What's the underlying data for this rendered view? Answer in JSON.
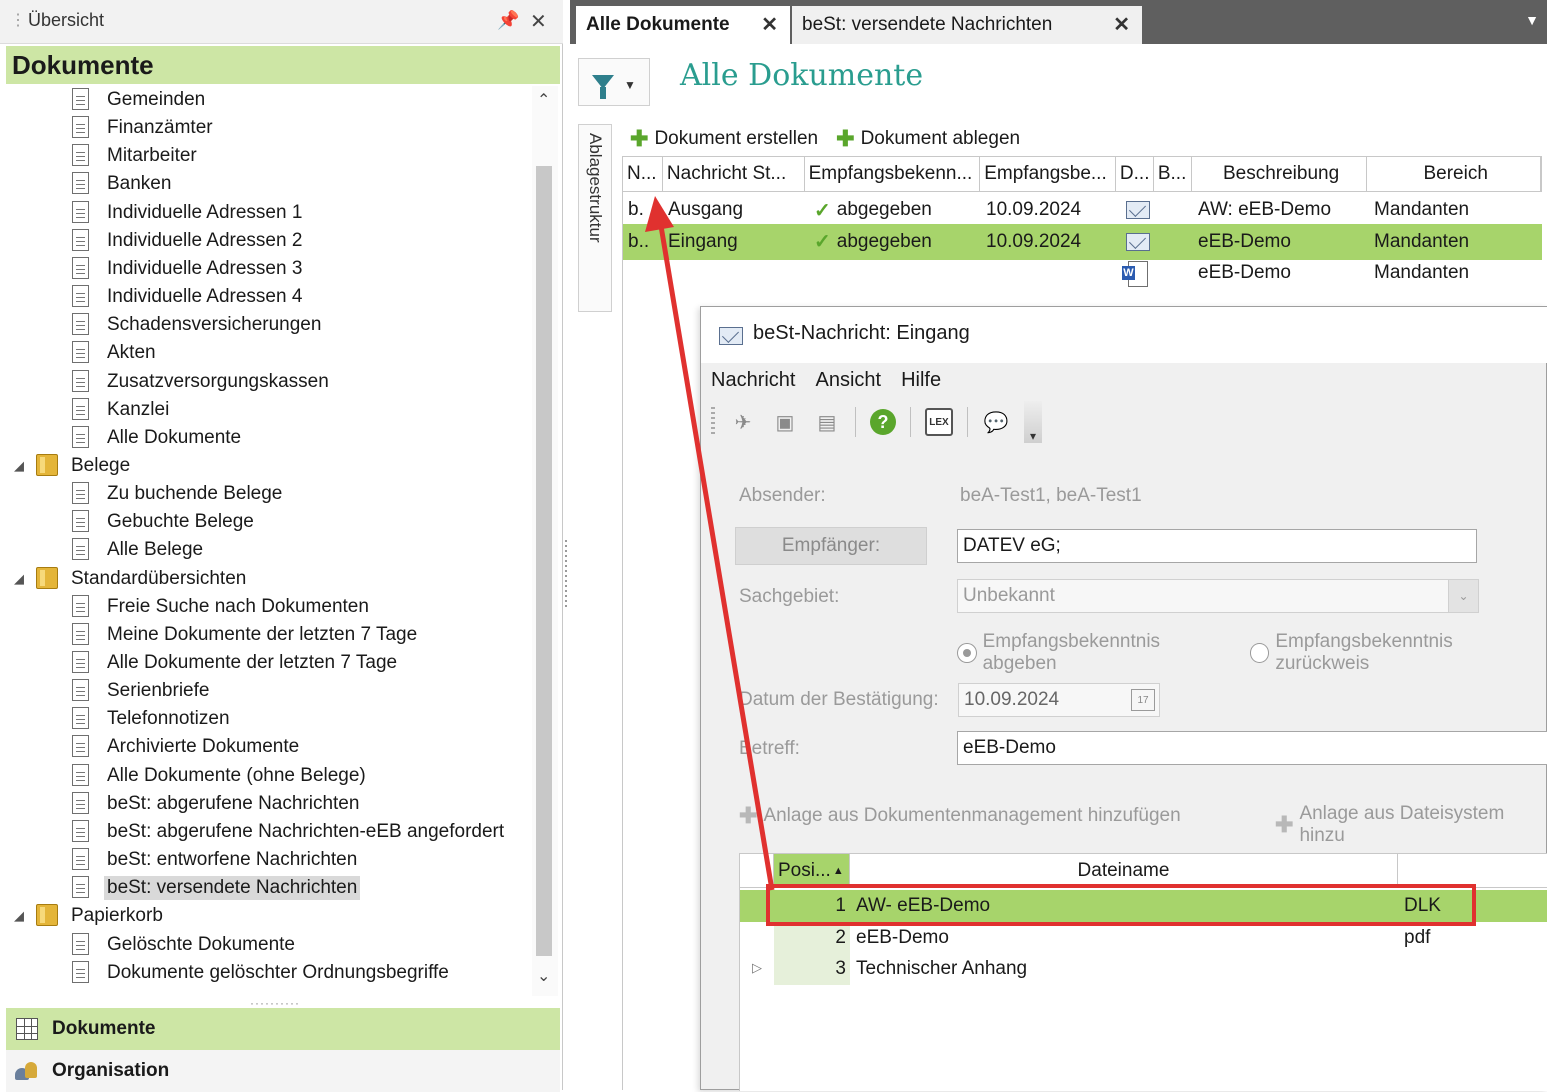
{
  "left_panel": {
    "title": "Übersicht",
    "header": "Dokumente",
    "tree": [
      {
        "label": "Gemeinden",
        "type": "doc",
        "level": 2
      },
      {
        "label": "Finanzämter",
        "type": "doc",
        "level": 2
      },
      {
        "label": "Mitarbeiter",
        "type": "doc",
        "level": 2
      },
      {
        "label": "Banken",
        "type": "doc",
        "level": 2
      },
      {
        "label": "Individuelle Adressen 1",
        "type": "doc",
        "level": 2
      },
      {
        "label": "Individuelle Adressen 2",
        "type": "doc",
        "level": 2
      },
      {
        "label": "Individuelle Adressen 3",
        "type": "doc",
        "level": 2
      },
      {
        "label": "Individuelle Adressen 4",
        "type": "doc",
        "level": 2
      },
      {
        "label": "Schadensversicherungen",
        "type": "doc",
        "level": 2
      },
      {
        "label": "Akten",
        "type": "doc",
        "level": 2
      },
      {
        "label": "Zusatzversorgungskassen",
        "type": "doc",
        "level": 2
      },
      {
        "label": "Kanzlei",
        "type": "doc",
        "level": 2
      },
      {
        "label": "Alle Dokumente",
        "type": "doc",
        "level": 2
      },
      {
        "label": "Belege",
        "type": "folder",
        "level": 1
      },
      {
        "label": "Zu buchende Belege",
        "type": "doc",
        "level": 2
      },
      {
        "label": "Gebuchte Belege",
        "type": "doc",
        "level": 2
      },
      {
        "label": "Alle Belege",
        "type": "doc",
        "level": 2
      },
      {
        "label": "Standardübersichten",
        "type": "folder",
        "level": 1
      },
      {
        "label": "Freie Suche nach Dokumenten",
        "type": "doc",
        "level": 2
      },
      {
        "label": "Meine Dokumente der letzten 7 Tage",
        "type": "doc",
        "level": 2
      },
      {
        "label": "Alle Dokumente der letzten 7 Tage",
        "type": "doc",
        "level": 2
      },
      {
        "label": "Serienbriefe",
        "type": "doc",
        "level": 2
      },
      {
        "label": "Telefonnotizen",
        "type": "doc",
        "level": 2
      },
      {
        "label": "Archivierte Dokumente",
        "type": "doc",
        "level": 2
      },
      {
        "label": "Alle Dokumente (ohne Belege)",
        "type": "doc",
        "level": 2
      },
      {
        "label": "beSt: abgerufene Nachrichten",
        "type": "doc",
        "level": 2
      },
      {
        "label": "beSt: abgerufene Nachrichten-eEB angefordert",
        "type": "doc",
        "level": 2
      },
      {
        "label": "beSt: entworfene Nachrichten",
        "type": "doc",
        "level": 2
      },
      {
        "label": "beSt: versendete Nachrichten",
        "type": "doc",
        "level": 2,
        "selected": true
      },
      {
        "label": "Papierkorb",
        "type": "folder",
        "level": 1
      },
      {
        "label": "Gelöschte Dokumente",
        "type": "doc",
        "level": 2
      },
      {
        "label": "Dokumente gelöschter Ordnungsbegriffe",
        "type": "doc",
        "level": 2
      }
    ],
    "nav": {
      "dokumente": "Dokumente",
      "organisation": "Organisation"
    }
  },
  "tabs": [
    {
      "label": "Alle Dokumente",
      "active": true
    },
    {
      "label": "beSt: versendete Nachrichten",
      "active": false
    }
  ],
  "main": {
    "title": "Alle Dokumente",
    "side_tab": "Ablagestruktur",
    "actions": {
      "create": "Dokument erstellen",
      "file": "Dokument ablegen"
    },
    "columns": [
      "N...",
      "Nachricht St...",
      "Empfangsbekenn...",
      "Empfangsbe...",
      "D...",
      "B...",
      "Beschreibung",
      "Bereich"
    ],
    "rows": [
      {
        "n": "b.",
        "status": "Ausgang",
        "ack": "abgegeben",
        "date": "10.09.2024",
        "icon": "envelope-icon",
        "desc": "AW: eEB-Demo",
        "area": "Mandanten",
        "highlight": false
      },
      {
        "n": "b..",
        "status": "Eingang",
        "ack": "abgegeben",
        "date": "10.09.2024",
        "icon": "envelope-icon",
        "desc": "eEB-Demo",
        "area": "Mandanten",
        "highlight": true
      },
      {
        "n": "",
        "status": "",
        "ack": "",
        "date": "",
        "icon": "word-document-icon",
        "desc": "eEB-Demo",
        "area": "Mandanten",
        "highlight": false
      }
    ]
  },
  "dialog": {
    "title": "beSt-Nachricht: Eingang",
    "menu": [
      "Nachricht",
      "Ansicht",
      "Hilfe"
    ],
    "absender_label": "Absender:",
    "absender_value": "beA-Test1, beA-Test1",
    "empfaenger_label": "Empfänger:",
    "empfaenger_value": "DATEV eG;",
    "sachgebiet_label": "Sachgebiet:",
    "sachgebiet_value": "Unbekannt",
    "radio_give": "Empfangsbekenntnis abgeben",
    "radio_reject": "Empfangsbekenntnis zurückweis",
    "datum_label": "Datum der Bestätigung:",
    "datum_value": "10.09.2024",
    "calendar_glyph": "17",
    "lex_label": "LEX",
    "betreff_label": "Betreff:",
    "betreff_value": "eEB-Demo",
    "action_dm": "Anlage aus Dokumentenmanagement hinzufügen",
    "action_fs": "Anlage aus Dateisystem hinzu",
    "att_columns": [
      "Posi...",
      "Dateiname"
    ],
    "attachments": [
      {
        "pos": "1",
        "name": "AW- eEB-Demo",
        "ext": "DLK",
        "highlight": true
      },
      {
        "pos": "2",
        "name": "eEB-Demo",
        "ext": "pdf",
        "highlight": false
      },
      {
        "pos": "3",
        "name": "Technischer Anhang",
        "ext": "",
        "highlight": false
      }
    ]
  },
  "colors": {
    "accent_green": "#a7d46b",
    "header_green": "#cde6a5",
    "title_teal": "#2a9d8f",
    "annotation_red": "#e0312f"
  }
}
